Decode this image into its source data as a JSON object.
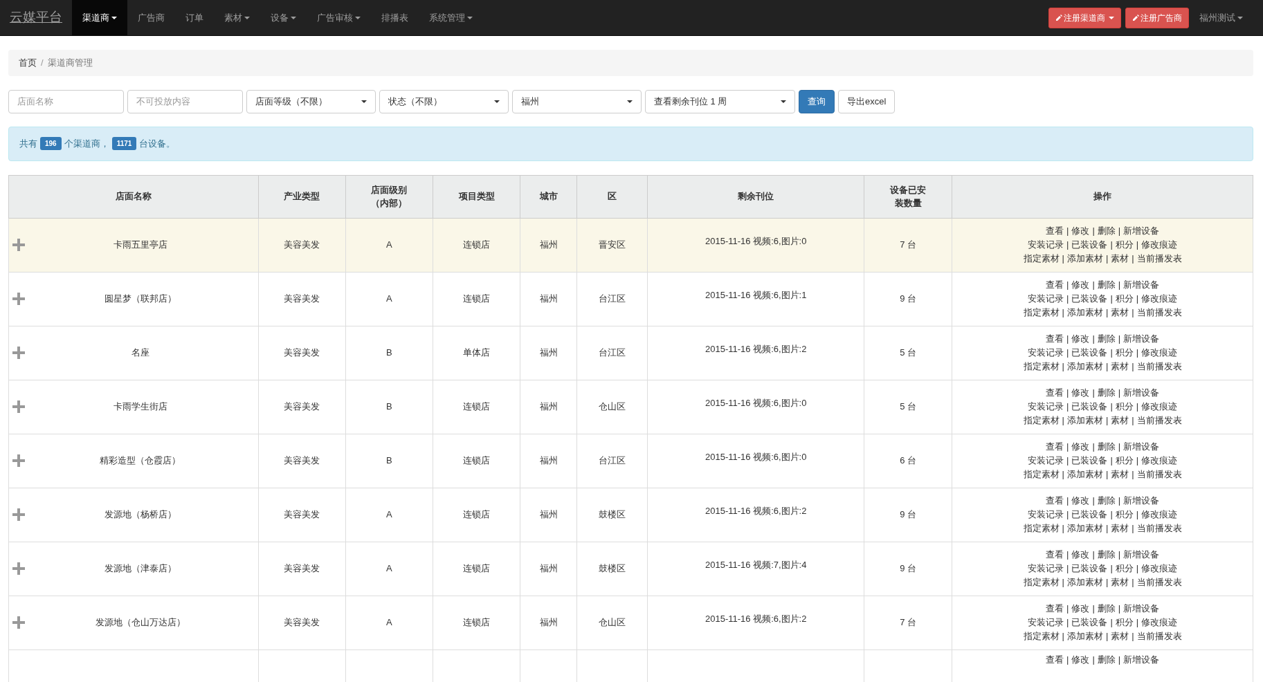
{
  "navbar": {
    "brand": "云媒平台",
    "items": [
      {
        "label": "渠道商",
        "dropdown": true,
        "selected": true
      },
      {
        "label": "广告商",
        "dropdown": false,
        "selected": false
      },
      {
        "label": "订单",
        "dropdown": false,
        "selected": false
      },
      {
        "label": "素材",
        "dropdown": true,
        "selected": false
      },
      {
        "label": "设备",
        "dropdown": true,
        "selected": false
      },
      {
        "label": "广告审核",
        "dropdown": true,
        "selected": false
      },
      {
        "label": "排播表",
        "dropdown": false,
        "selected": false
      },
      {
        "label": "系统管理",
        "dropdown": true,
        "selected": false
      }
    ],
    "register_buttons": [
      {
        "label": "注册渠道商",
        "dropdown": true
      },
      {
        "label": "注册广告商",
        "dropdown": false
      }
    ],
    "user": {
      "label": "福州测试",
      "dropdown": true
    }
  },
  "breadcrumb_separator": "/",
  "breadcrumb": [
    {
      "label": "首页",
      "active": false
    },
    {
      "label": "渠道商管理",
      "active": true
    }
  ],
  "filters": {
    "inputs": [
      {
        "placeholder": "店面名称"
      },
      {
        "placeholder": "不可投放内容"
      }
    ],
    "selects": [
      {
        "value": "店面等级（不限）"
      },
      {
        "value": "状态（不限）"
      },
      {
        "value": "福州"
      },
      {
        "value": "查看剩余刊位 1 周"
      }
    ],
    "buttons": [
      {
        "label": "查询",
        "kind": "primary"
      },
      {
        "label": "导出excel",
        "kind": "default"
      }
    ]
  },
  "summary": [
    {
      "kind": "text",
      "text": "共有"
    },
    {
      "kind": "badge",
      "text": "196"
    },
    {
      "kind": "text",
      "text": "个渠道商，"
    },
    {
      "kind": "badge",
      "text": "1171"
    },
    {
      "kind": "text",
      "text": "台设备。"
    }
  ],
  "table": {
    "action_separator": "|",
    "columns": [
      "店面名称",
      "产业类型",
      "店面级别（内部）",
      "项目类型",
      "城市",
      "区",
      "剩余刊位",
      "设备已安装数量",
      "操作"
    ],
    "rows": [
      {
        "selected": true,
        "name": "卡雨五里亭店",
        "industry": "美容美发",
        "level": "A",
        "project": "连锁店",
        "city": "福州",
        "district": "晋安区",
        "slots": "2015-11-16 视频:6,图片:0",
        "installed": "7 台",
        "actions": [
          [
            "查看",
            "修改",
            "删除",
            "新增设备"
          ],
          [
            "安装记录",
            "已装设备",
            "积分",
            "修改痕迹"
          ],
          [
            "指定素材",
            "添加素材",
            "素材",
            "当前播发表"
          ]
        ]
      },
      {
        "selected": false,
        "name": "圆星梦（联邦店）",
        "industry": "美容美发",
        "level": "A",
        "project": "连锁店",
        "city": "福州",
        "district": "台江区",
        "slots": "2015-11-16 视频:6,图片:1",
        "installed": "9 台",
        "actions": [
          [
            "查看",
            "修改",
            "删除",
            "新增设备"
          ],
          [
            "安装记录",
            "已装设备",
            "积分",
            "修改痕迹"
          ],
          [
            "指定素材",
            "添加素材",
            "素材",
            "当前播发表"
          ]
        ]
      },
      {
        "selected": false,
        "name": "名座",
        "industry": "美容美发",
        "level": "B",
        "project": "单体店",
        "city": "福州",
        "district": "台江区",
        "slots": "2015-11-16 视频:6,图片:2",
        "installed": "5 台",
        "actions": [
          [
            "查看",
            "修改",
            "删除",
            "新增设备"
          ],
          [
            "安装记录",
            "已装设备",
            "积分",
            "修改痕迹"
          ],
          [
            "指定素材",
            "添加素材",
            "素材",
            "当前播发表"
          ]
        ]
      },
      {
        "selected": false,
        "name": "卡雨学生街店",
        "industry": "美容美发",
        "level": "B",
        "project": "连锁店",
        "city": "福州",
        "district": "仓山区",
        "slots": "2015-11-16 视频:6,图片:0",
        "installed": "5 台",
        "actions": [
          [
            "查看",
            "修改",
            "删除",
            "新增设备"
          ],
          [
            "安装记录",
            "已装设备",
            "积分",
            "修改痕迹"
          ],
          [
            "指定素材",
            "添加素材",
            "素材",
            "当前播发表"
          ]
        ]
      },
      {
        "selected": false,
        "name": "精彩造型（仓霞店）",
        "industry": "美容美发",
        "level": "B",
        "project": "连锁店",
        "city": "福州",
        "district": "台江区",
        "slots": "2015-11-16 视频:6,图片:0",
        "installed": "6 台",
        "actions": [
          [
            "查看",
            "修改",
            "删除",
            "新增设备"
          ],
          [
            "安装记录",
            "已装设备",
            "积分",
            "修改痕迹"
          ],
          [
            "指定素材",
            "添加素材",
            "素材",
            "当前播发表"
          ]
        ]
      },
      {
        "selected": false,
        "name": "发源地（杨桥店）",
        "industry": "美容美发",
        "level": "A",
        "project": "连锁店",
        "city": "福州",
        "district": "鼓楼区",
        "slots": "2015-11-16 视频:6,图片:2",
        "installed": "9 台",
        "actions": [
          [
            "查看",
            "修改",
            "删除",
            "新增设备"
          ],
          [
            "安装记录",
            "已装设备",
            "积分",
            "修改痕迹"
          ],
          [
            "指定素材",
            "添加素材",
            "素材",
            "当前播发表"
          ]
        ]
      },
      {
        "selected": false,
        "name": "发源地（津泰店）",
        "industry": "美容美发",
        "level": "A",
        "project": "连锁店",
        "city": "福州",
        "district": "鼓楼区",
        "slots": "2015-11-16 视频:7,图片:4",
        "installed": "9 台",
        "actions": [
          [
            "查看",
            "修改",
            "删除",
            "新增设备"
          ],
          [
            "安装记录",
            "已装设备",
            "积分",
            "修改痕迹"
          ],
          [
            "指定素材",
            "添加素材",
            "素材",
            "当前播发表"
          ]
        ]
      },
      {
        "selected": false,
        "name": "发源地（仓山万达店）",
        "industry": "美容美发",
        "level": "A",
        "project": "连锁店",
        "city": "福州",
        "district": "仓山区",
        "slots": "2015-11-16 视频:6,图片:2",
        "installed": "7 台",
        "actions": [
          [
            "查看",
            "修改",
            "删除",
            "新增设备"
          ],
          [
            "安装记录",
            "已装设备",
            "积分",
            "修改痕迹"
          ],
          [
            "指定素材",
            "添加素材",
            "素材",
            "当前播发表"
          ]
        ]
      },
      {
        "selected": false,
        "actions": [
          [
            "查看",
            "修改",
            "删除",
            "新增设备"
          ]
        ]
      }
    ]
  }
}
